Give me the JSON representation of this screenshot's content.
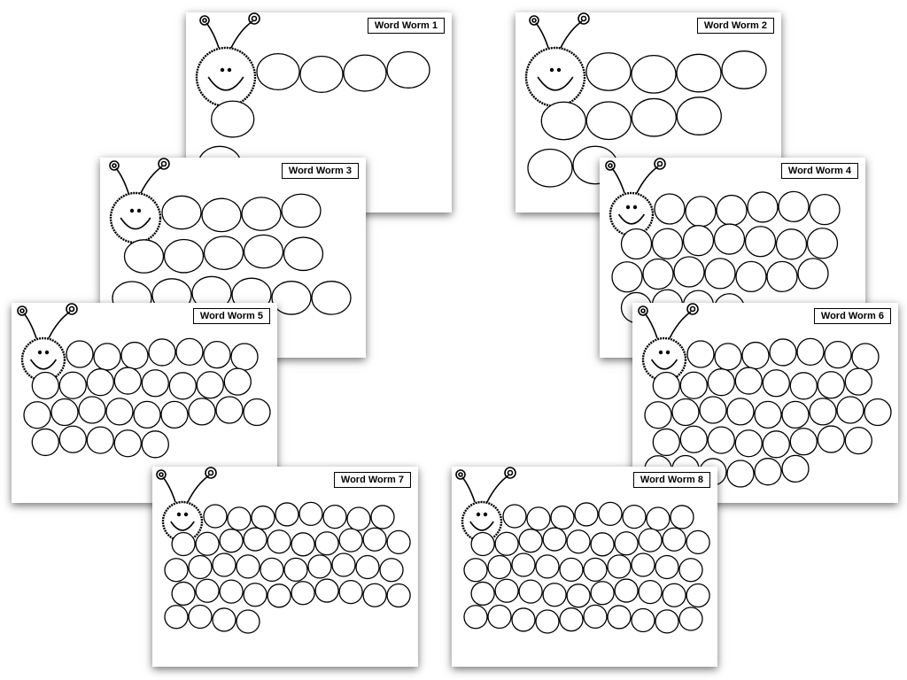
{
  "worksheets": [
    {
      "title": "Word Worm 1"
    },
    {
      "title": "Word Worm 2"
    },
    {
      "title": "Word Worm 3"
    },
    {
      "title": "Word Worm 4"
    },
    {
      "title": "Word Worm 5"
    },
    {
      "title": "Word Worm 6"
    },
    {
      "title": "Word Worm 7"
    },
    {
      "title": "Word Worm 8"
    }
  ]
}
